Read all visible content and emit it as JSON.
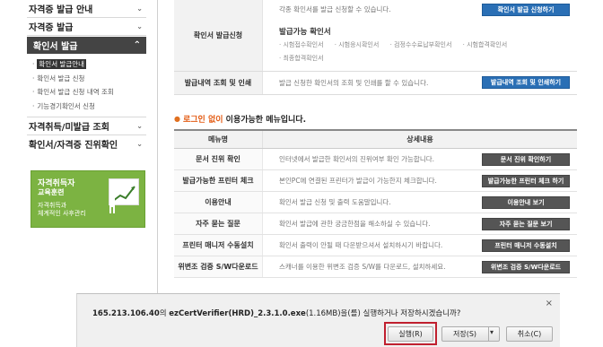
{
  "sidebar": {
    "menu1": "자격증 발급 안내",
    "menu2": "자격증 발급",
    "menu3": "확인서 발급",
    "sub": [
      "확인서 발급안내",
      "확인서 발급 신청",
      "확인서 발급 신청 내역 조회",
      "기능경기확인서 신청"
    ],
    "menu4": "자격취득/미발급 조회",
    "menu5": "확인서/자격증 진위확인",
    "arrow_down": "⌄",
    "arrow_up": "⌃"
  },
  "banner": {
    "line1": "자격취득자",
    "line2": "교육훈련",
    "line3": "자격취득과",
    "line4": "체계적인 사후관리"
  },
  "apply_section": {
    "top_desc": "각종 확인서를 발급 신청할 수 있습니다.",
    "top_button": "확인서 발급 신청하기",
    "head": "확인서 발급신청",
    "list_title": "발급가능 확인서",
    "items": [
      "시험접수확인서",
      "시험응시확인서",
      "검정수수료납부확인서",
      "시험합격확인서",
      "최종합격확인서"
    ],
    "history_head": "발급내역 조회 및 인쇄",
    "history_desc": "발급 신청한 확인서의 조회 및 인쇄를 할 수 있습니다.",
    "history_button": "발급내역 조회 및 인쇄하기"
  },
  "section_title": {
    "bullet": "●",
    "orange": "로그인 없이",
    "rest": " 이용가능한 메뉴입니다."
  },
  "table2": {
    "col1": "메뉴명",
    "col2": "상세내용",
    "rows": [
      {
        "name": "문서 진위 확인",
        "desc": "인터넷에서 발급한 확인서의 진위여부 확인 가능합니다.",
        "button": "문서 진위 확인하기"
      },
      {
        "name": "발급가능한 프린터 체크",
        "desc": "본인PC에 연결된 프린터가 발급이 가능한지 체크합니다.",
        "button": "발급가능한 프린터 체크 하기"
      },
      {
        "name": "이용안내",
        "desc": "확인서 발급 신청 및 출력 도움말입니다.",
        "button": "이용안내 보기"
      },
      {
        "name": "자주 묻는 질문",
        "desc": "확인서 발급에 관한 궁금한점을 해소하실 수 있습니다.",
        "button": "자주 묻는 질문 보기"
      },
      {
        "name": "프린터 매니저 수동설치",
        "desc": "확인서 출력이 안될 때 다운받으셔서 설치하시기 바랍니다.",
        "button": "프린터 매니저 수동설치"
      },
      {
        "name": "위변조 검증 S/W다운로드",
        "desc": "스캐너를 이용한 위변조 검증 S/W를 다운로드, 설치하세요.",
        "button": "위변조 검증 S/W다운로드"
      }
    ]
  },
  "download_bar": {
    "host": "165.213.106.40",
    "mid": "의 ",
    "file": "ezCertVerifier(HRD)_2.3.1.0.exe",
    "tail": "(1.16MB)을(를) 실행하거나 저장하시겠습니까?",
    "run": "실행(R)",
    "save": "저장(S)",
    "save_arrow": "▾",
    "cancel": "취소(C)",
    "close": "×",
    "highlight_color": "#c0202f"
  }
}
